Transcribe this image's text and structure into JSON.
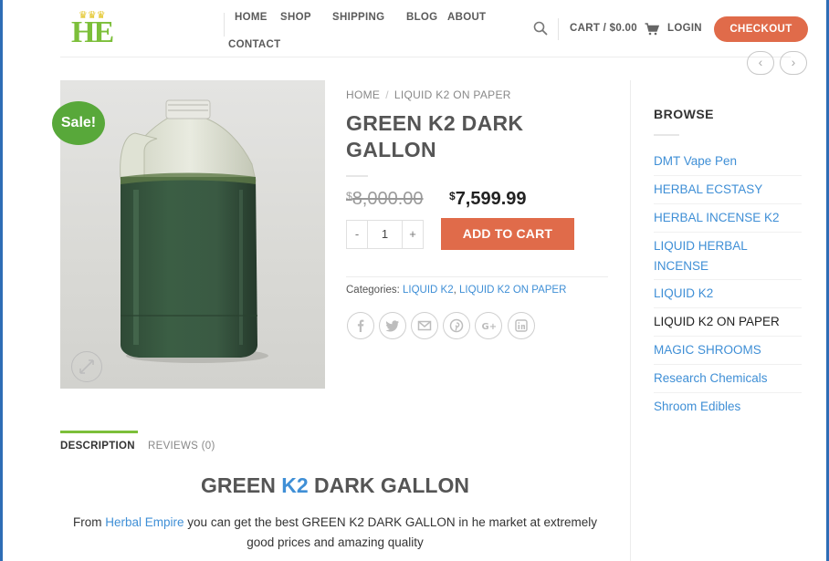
{
  "header": {
    "logo_text": "HE",
    "nav": [
      {
        "label": "HOME",
        "has_dropdown": false
      },
      {
        "label": "SHOP",
        "has_dropdown": true
      },
      {
        "label": "SHIPPING",
        "has_dropdown": true
      },
      {
        "label": "BLOG",
        "has_dropdown": false
      },
      {
        "label": "ABOUT",
        "has_dropdown": false
      },
      {
        "label": "CONTACT",
        "has_dropdown": false
      }
    ],
    "cart_label": "CART / $0.00",
    "login_label": "LOGIN",
    "checkout_label": "CHECKOUT"
  },
  "product": {
    "sale_badge": "Sale!",
    "breadcrumb": [
      "HOME",
      "LIQUID K2 ON PAPER"
    ],
    "breadcrumb_sep": "/",
    "title": "GREEN K2 DARK GALLON",
    "old_price_symbol": "$",
    "old_price": "8,000.00",
    "new_price_symbol": "$",
    "new_price": "7,599.99",
    "quantity": "1",
    "qty_minus": "-",
    "qty_plus": "+",
    "add_to_cart": "ADD TO CART",
    "categories_label": "Categories:",
    "categories": [
      "LIQUID K2",
      "LIQUID K2 ON PAPER"
    ],
    "categories_sep": ","
  },
  "sidebar": {
    "title": "BROWSE",
    "items": [
      {
        "label": "DMT Vape Pen",
        "active": false
      },
      {
        "label": "HERBAL ECSTASY",
        "active": false
      },
      {
        "label": "HERBAL INCENSE K2",
        "active": false
      },
      {
        "label": "LIQUID HERBAL INCENSE",
        "active": false
      },
      {
        "label": "LIQUID K2",
        "active": false
      },
      {
        "label": "LIQUID K2 ON PAPER",
        "active": true
      },
      {
        "label": "MAGIC SHROOMS",
        "active": false
      },
      {
        "label": "Research Chemicals",
        "active": false
      },
      {
        "label": "Shroom Edibles",
        "active": false
      }
    ]
  },
  "tabs": [
    {
      "label": "DESCRIPTION",
      "active": true
    },
    {
      "label": "REVIEWS (0)",
      "active": false
    }
  ],
  "description": {
    "title_part1": "GREEN",
    "title_part2": "K2",
    "title_part3": "DARK GALLON",
    "text_part1": "From",
    "text_link": "Herbal Empire",
    "text_part2": "you can get the best GREEN K2 DARK GALLON in he market at extremely good prices and amazing quality"
  },
  "colors": {
    "accent": "#e06b4a",
    "link": "#3f8fd6",
    "sale_green": "#58a83a",
    "tab_green": "#7cbf3a",
    "frame_blue": "#2e6db5"
  },
  "icons": [
    "search-icon",
    "cart-icon",
    "facebook-icon",
    "twitter-icon",
    "email-icon",
    "pinterest-icon",
    "google-plus-icon",
    "linkedin-icon",
    "expand-icon",
    "chevron-left-icon",
    "chevron-right-icon",
    "crown-icon"
  ]
}
